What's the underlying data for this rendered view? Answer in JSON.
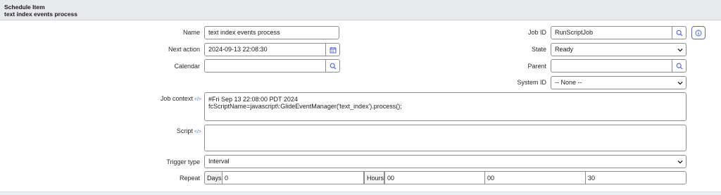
{
  "header": {
    "title": "Schedule Item",
    "subtitle": "text index events process"
  },
  "form": {
    "name": {
      "label": "Name",
      "value": "text index events process"
    },
    "next_action": {
      "label": "Next action",
      "value": "2024-09-13 22:08:30"
    },
    "calendar": {
      "label": "Calendar",
      "value": ""
    },
    "job_id": {
      "label": "Job ID",
      "value": "RunScriptJob"
    },
    "state": {
      "label": "State",
      "value": "Ready"
    },
    "parent": {
      "label": "Parent",
      "value": ""
    },
    "system_id": {
      "label": "System ID",
      "value": "-- None --"
    },
    "job_context": {
      "label": "Job context",
      "lines": [
        "#Fri Sep 13 22:08:00 PDT 2024",
        "fcScriptName=javascript\\:GlideEventManager('text_index').process();"
      ]
    },
    "script": {
      "label": "Script",
      "value": ""
    },
    "trigger_type": {
      "label": "Trigger type",
      "value": "Interval"
    },
    "repeat": {
      "label": "Repeat",
      "days_label": "Days",
      "days_value": "0",
      "hours_label": "Hours",
      "hours_value": "00",
      "minutes_value": "00",
      "seconds_value": "30"
    }
  },
  "icons": {
    "search": "search-icon",
    "calendar": "calendar-icon",
    "info": "info-icon",
    "chevron": "chevron-down-icon",
    "code": "script-code-icon"
  }
}
